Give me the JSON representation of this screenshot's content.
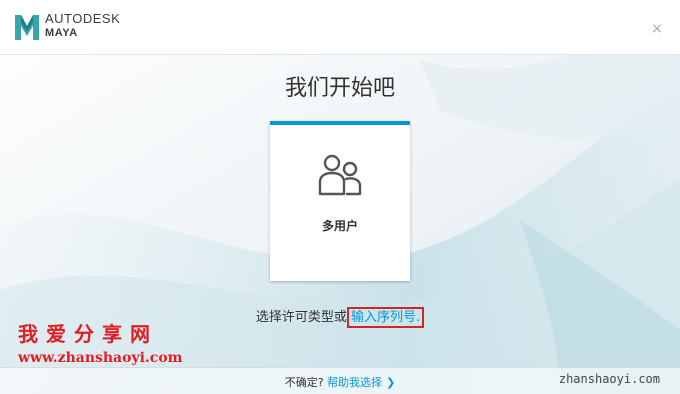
{
  "app": {
    "brand_line1": "AUTODESK",
    "brand_line2": "MAYA",
    "close_glyph": "×"
  },
  "main": {
    "title": "我们开始吧",
    "card": {
      "icon": "multi-user-icon",
      "label": "多用户"
    },
    "license_prefix": "选择许可类型或",
    "license_link": "输入序列号."
  },
  "footer": {
    "question": "不确定?",
    "help_link": "帮助我选择",
    "chevron": "❯"
  },
  "watermark": {
    "site_name": "我爱分享网",
    "url_left": "www.zhanshaoyi.com",
    "url_right": "zhanshaoyi.com"
  },
  "colors": {
    "accent": "#0696d7",
    "highlight_box": "#d4232b",
    "watermark_red": "#e11e23",
    "logo_teal": "#37a5aa"
  }
}
